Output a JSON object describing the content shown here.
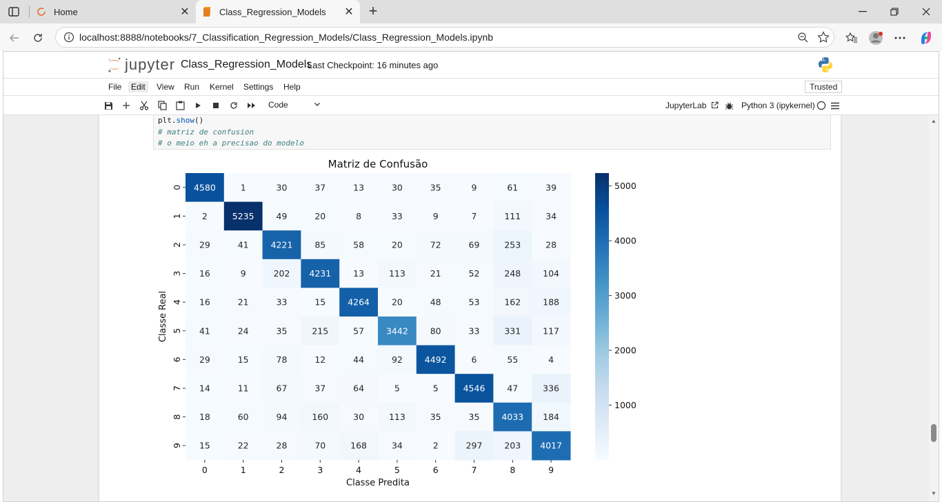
{
  "browser": {
    "tabs": [
      {
        "title": "Home",
        "active": false
      },
      {
        "title": "Class_Regression_Models",
        "active": true
      }
    ],
    "url": "localhost:8888/notebooks/7_Classification_Regression_Models/Class_Regression_Models.ipynb"
  },
  "jupyter": {
    "logo_text": "jupyter",
    "notebook_title": "Class_Regression_Models",
    "checkpoint": "Last Checkpoint: 16 minutes ago",
    "menu": [
      "File",
      "Edit",
      "View",
      "Run",
      "Kernel",
      "Settings",
      "Help"
    ],
    "highlighted_menu": "Edit",
    "trusted": "Trusted",
    "cell_type": "Code",
    "jupyterlab_link": "JupyterLab",
    "kernel": "Python 3 (ipykernel)"
  },
  "code": {
    "lines": [
      {
        "kind": "call",
        "obj": "plt.",
        "method": "show",
        "suffix": "()"
      },
      {
        "kind": "comment",
        "text": "# matriz de confusion"
      },
      {
        "kind": "comment",
        "text": "# o meio eh a precisao do modelo"
      }
    ]
  },
  "chart_data": {
    "type": "heatmap",
    "title": "Matriz de Confusão",
    "xlabel": "Classe Predita",
    "ylabel": "Classe Real",
    "x_categories": [
      "0",
      "1",
      "2",
      "3",
      "4",
      "5",
      "6",
      "7",
      "8",
      "9"
    ],
    "y_categories": [
      "0",
      "1",
      "2",
      "3",
      "4",
      "5",
      "6",
      "7",
      "8",
      "9"
    ],
    "colormap": "Blues",
    "color_range": [
      0,
      5235
    ],
    "colorbar_ticks": [
      1000,
      2000,
      3000,
      4000,
      5000
    ],
    "values": [
      [
        4580,
        1,
        30,
        37,
        13,
        30,
        35,
        9,
        61,
        39
      ],
      [
        2,
        5235,
        49,
        20,
        8,
        33,
        9,
        7,
        111,
        34
      ],
      [
        29,
        41,
        4221,
        85,
        58,
        20,
        72,
        69,
        253,
        28
      ],
      [
        16,
        9,
        202,
        4231,
        13,
        113,
        21,
        52,
        248,
        104
      ],
      [
        16,
        21,
        33,
        15,
        4264,
        20,
        48,
        53,
        162,
        188
      ],
      [
        41,
        24,
        35,
        215,
        57,
        3442,
        80,
        33,
        331,
        117
      ],
      [
        29,
        15,
        78,
        12,
        44,
        92,
        4492,
        6,
        55,
        4
      ],
      [
        14,
        11,
        67,
        37,
        64,
        5,
        5,
        4546,
        47,
        336
      ],
      [
        18,
        60,
        94,
        160,
        30,
        113,
        35,
        35,
        4033,
        184
      ],
      [
        15,
        22,
        28,
        70,
        168,
        34,
        2,
        297,
        203,
        4017
      ]
    ]
  }
}
